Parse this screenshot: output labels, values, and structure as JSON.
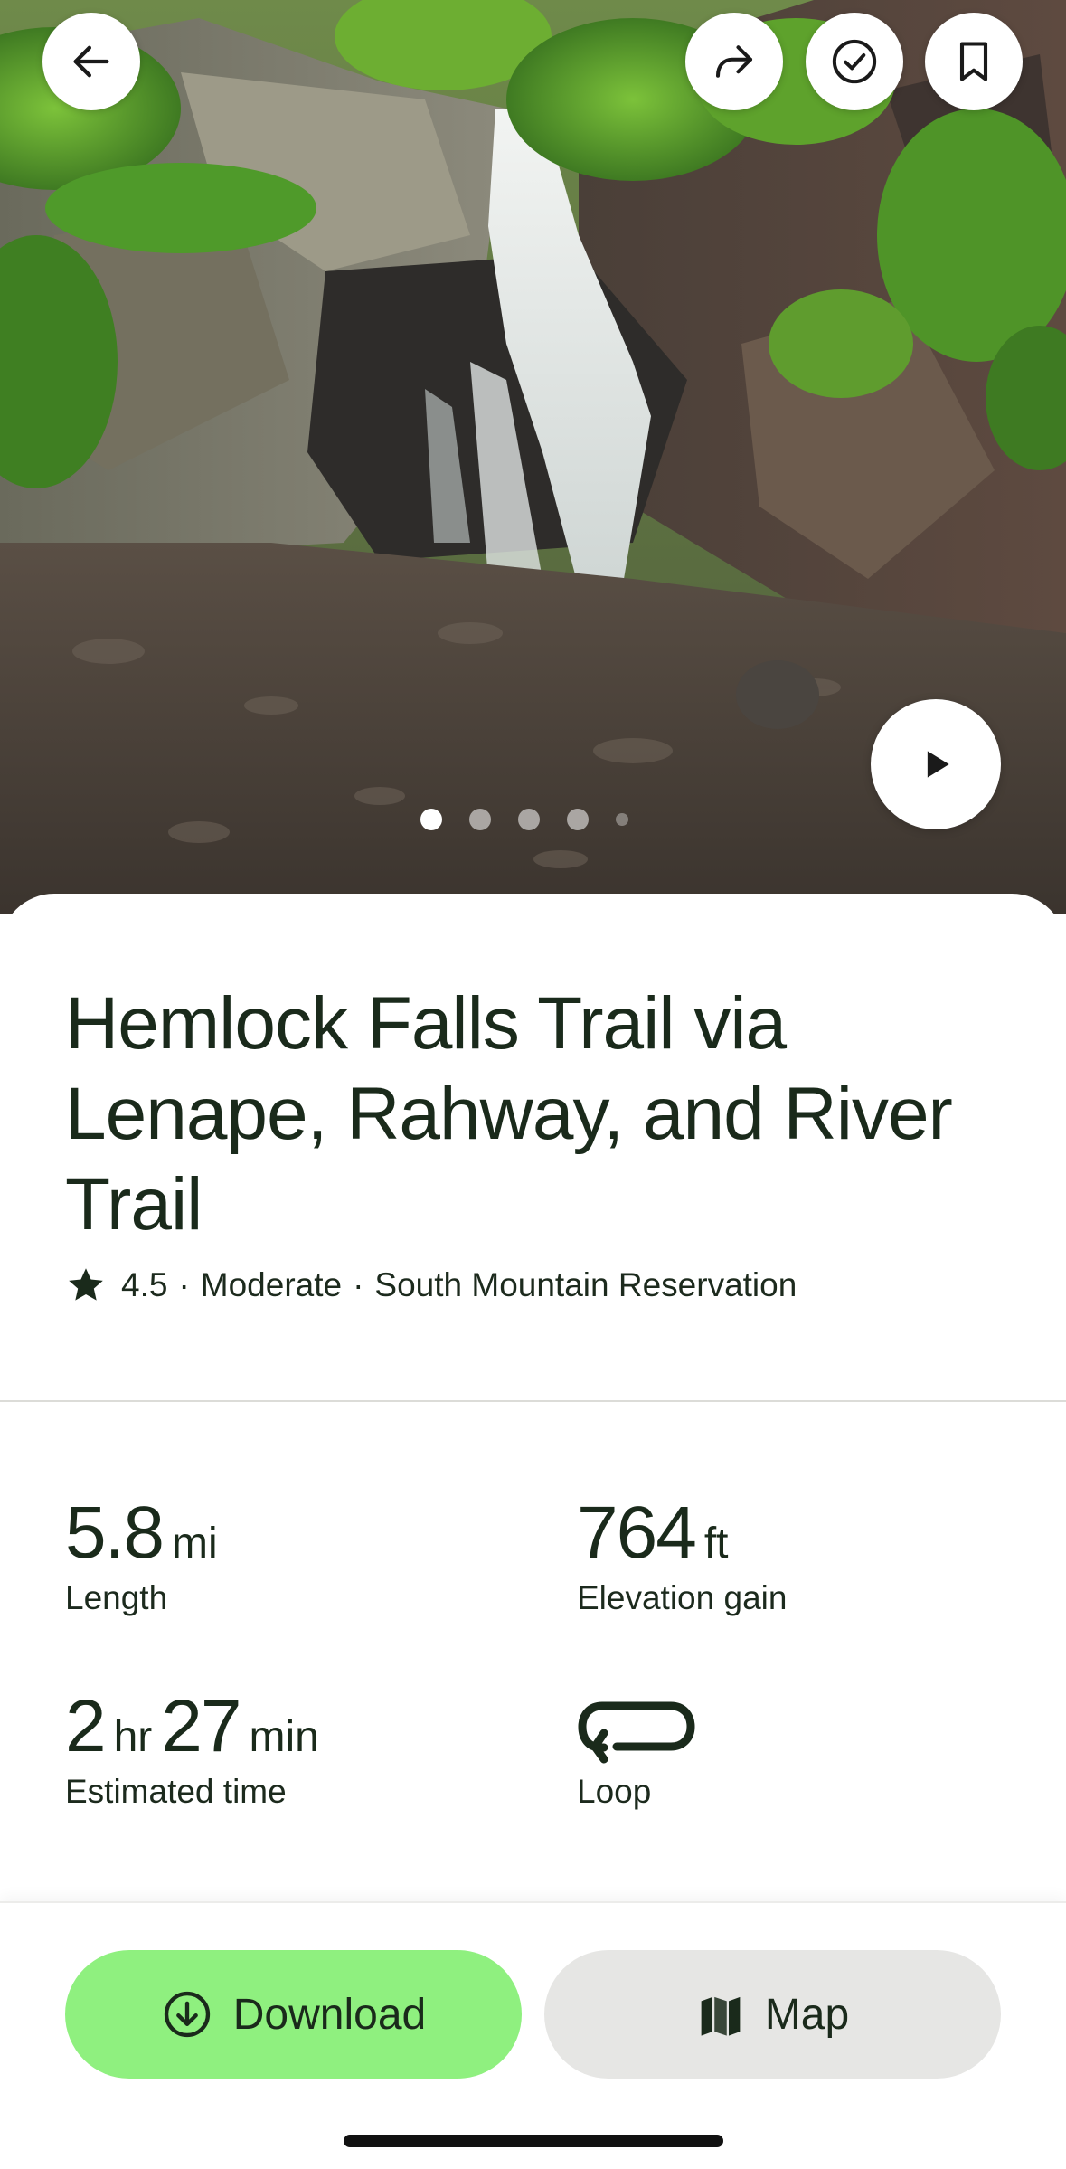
{
  "hero": {
    "photo_subject": "waterfall",
    "photo_count": 5,
    "active_photo_index": 0
  },
  "top_actions": {
    "back_icon": "arrow-left-icon",
    "share_icon": "share-arrow-icon",
    "completed_icon": "check-circle-icon",
    "save_icon": "bookmark-icon"
  },
  "trail": {
    "name": "Hemlock Falls Trail via Lenape, Rahway, and River Trail",
    "rating": "4.5",
    "separator": "·",
    "difficulty": "Moderate",
    "park": "South Mountain Reservation"
  },
  "stats": {
    "length": {
      "value": "5.8",
      "unit": "mi",
      "label": "Length"
    },
    "elevation": {
      "value": "764",
      "unit": "ft",
      "label": "Elevation gain"
    },
    "time": {
      "hours": "2",
      "hours_unit": "hr",
      "minutes": "27",
      "minutes_unit": "min",
      "label": "Estimated time"
    },
    "route_type": {
      "icon": "loop-icon",
      "label": "Loop"
    }
  },
  "bottom_bar": {
    "download_label": "Download",
    "map_label": "Map"
  },
  "colors": {
    "download_bg": "#8ff07f",
    "map_bg": "#e6e6e4",
    "text_dark": "#1a2a1b"
  }
}
